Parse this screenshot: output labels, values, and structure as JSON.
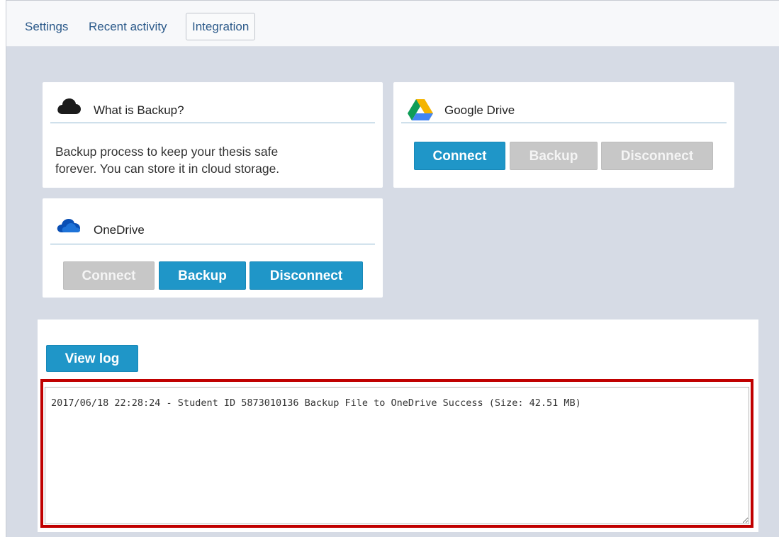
{
  "tabs": [
    {
      "label": "Settings"
    },
    {
      "label": "Recent activity"
    },
    {
      "label": "Integration",
      "active": true
    }
  ],
  "backup_info": {
    "title": "What is Backup?",
    "icon": "cloud-icon",
    "text_line1": "Backup process to keep your thesis safe",
    "text_line2": "forever. You can store it in cloud storage."
  },
  "google_drive": {
    "title": "Google Drive",
    "icon": "google-drive-icon",
    "connect_label": "Connect",
    "backup_label": "Backup",
    "disconnect_label": "Disconnect"
  },
  "onedrive": {
    "title": "OneDrive",
    "icon": "onedrive-icon",
    "connect_label": "Connect",
    "backup_label": "Backup",
    "disconnect_label": "Disconnect"
  },
  "log": {
    "view_log_label": "View log",
    "content": "2017/06/18 22:28:24 - Student ID 5873010136 Backup File to OneDrive Success (Size: 42.51 MB)"
  },
  "colors": {
    "accent": "#1f96c8",
    "disabled": "#c7c7c7",
    "highlight": "#c00000",
    "background": "#d6dbe5"
  }
}
